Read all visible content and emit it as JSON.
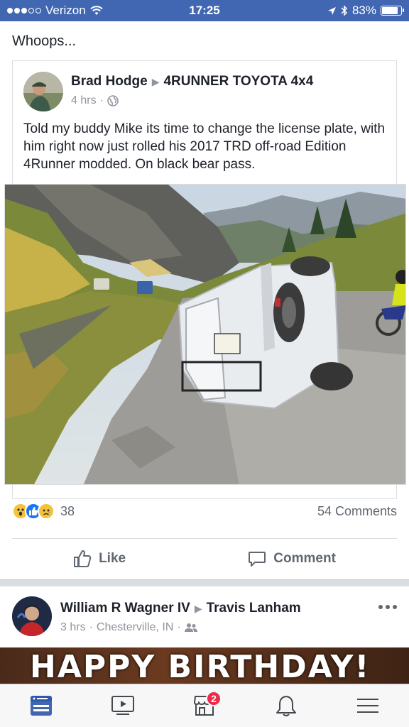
{
  "status_bar": {
    "carrier": "Verizon",
    "time": "17:25",
    "battery": "83%",
    "battery_level": 0.83
  },
  "feed": {
    "story_caption": "Whoops...",
    "shared_post": {
      "author": "Brad Hodge",
      "group": "4RUNNER TOYOTA 4x4",
      "time": "4 hrs",
      "privacy_icon": "globe-icon",
      "text": "Told my buddy Mike its time to change the license plate, with him right now just rolled his 2017 TRD off-road Edition 4Runner modded. On black bear pass."
    },
    "reactions": {
      "icons": [
        "wow-reaction-icon",
        "like-reaction-icon",
        "sad-reaction-icon"
      ],
      "count": "38",
      "comments": "54 Comments"
    },
    "actions": {
      "like": "Like",
      "comment": "Comment"
    },
    "next_post": {
      "author": "William R Wagner IV",
      "target": "Travis Lanham",
      "time": "3 hrs",
      "location": "Chesterville, IN",
      "banner_text": "HAPPY BIRTHDAY!"
    }
  },
  "tabbar": {
    "items": [
      {
        "name": "news-feed",
        "icon": "news-feed-icon",
        "active": true
      },
      {
        "name": "watch",
        "icon": "video-icon"
      },
      {
        "name": "marketplace",
        "icon": "marketplace-icon",
        "badge": "2"
      },
      {
        "name": "notifications",
        "icon": "bell-icon"
      },
      {
        "name": "menu",
        "icon": "menu-icon"
      }
    ]
  },
  "colors": {
    "brand": "#4267b2",
    "text": "#1d2129",
    "secondary_text": "#606770",
    "badge": "#f02849"
  }
}
